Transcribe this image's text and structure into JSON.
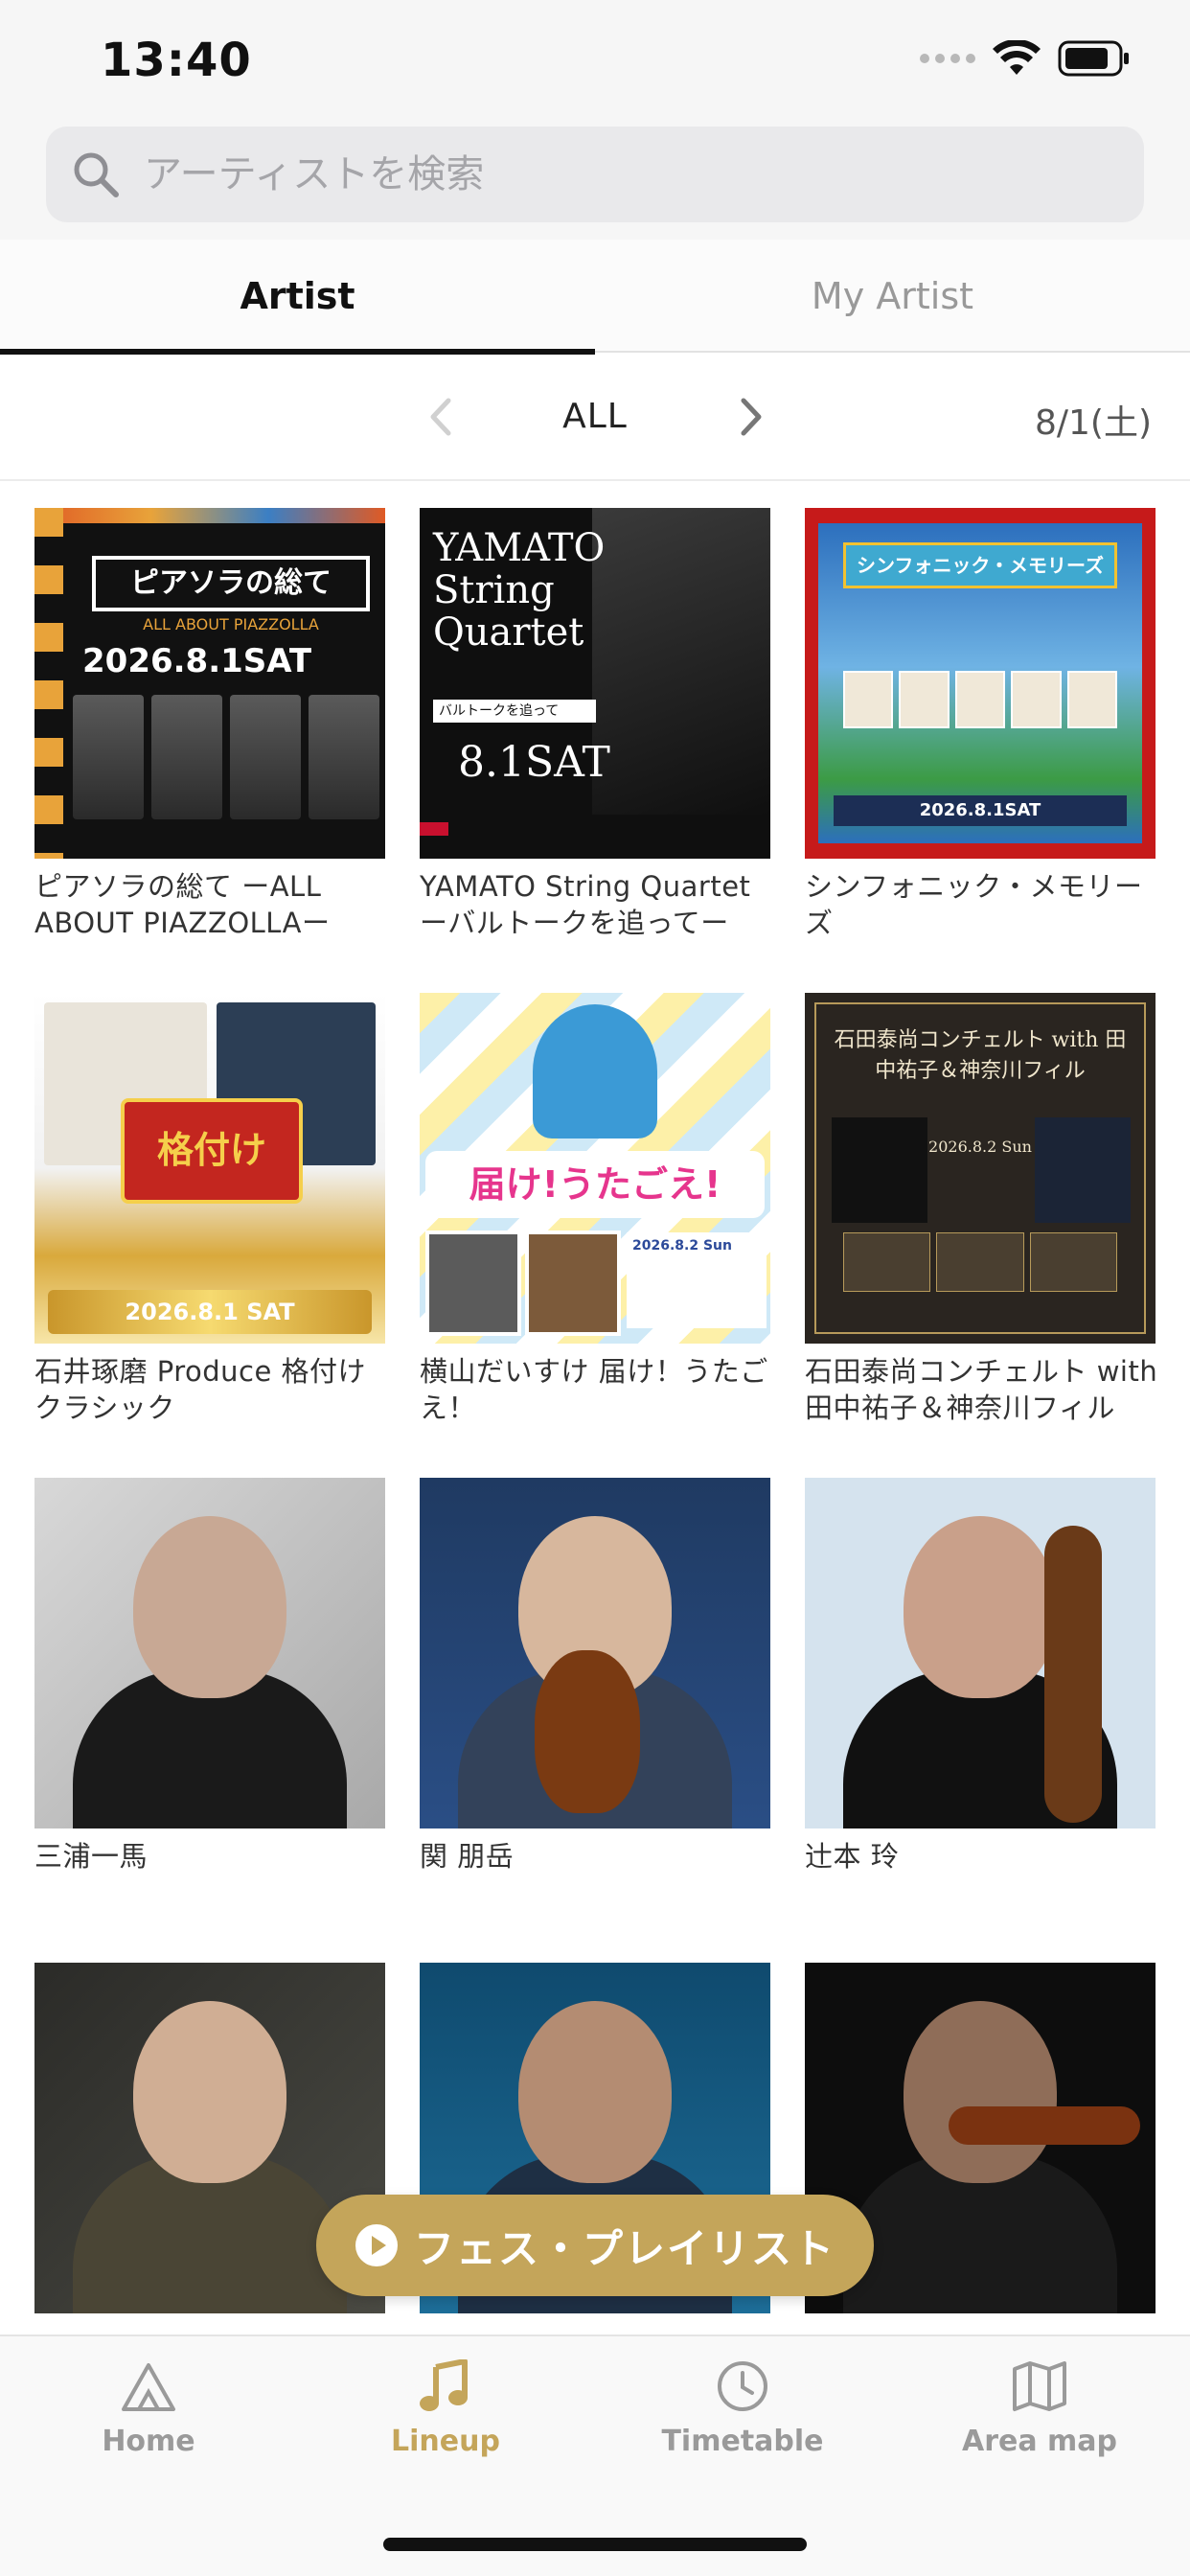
{
  "status": {
    "time": "13:40"
  },
  "search": {
    "placeholder": "アーティストを検索"
  },
  "tabs": [
    {
      "label": "Artist",
      "active": true
    },
    {
      "label": "My Artist",
      "active": false
    }
  ],
  "filter": {
    "label": "ALL",
    "date": "8/1(土)"
  },
  "cards": [
    {
      "title": "ピアソラの総て ーALL ABOUT PIAZZOLLAー",
      "poster_title": "ピアソラの総て",
      "poster_sub": "ALL ABOUT PIAZZOLLA",
      "poster_date": "2026.8.1SAT"
    },
    {
      "title": "YAMATO String Quartet ーバルトークを追ってー",
      "poster_title": "YAMATO String Quartet",
      "poster_sub": "バルトークを追って",
      "poster_date": "8.1SAT"
    },
    {
      "title": "シンフォニック・メモリーズ",
      "poster_title": "シンフォニック・メモリーズ",
      "poster_date": "2026.8.1SAT"
    },
    {
      "title": "石井琢磨 Produce 格付けクラシック",
      "poster_title": "格付け",
      "poster_date": "2026.8.1 SAT"
    },
    {
      "title": "横山だいすけ 届け！うたごえ！",
      "poster_title": "届け!うたごえ!",
      "poster_date": "2026.8.2 Sun"
    },
    {
      "title": "石田泰尚コンチェルト with 田中祐子＆神奈川フィル",
      "poster_title": "石田泰尚コンチェルト with 田中祐子＆神奈川フィル",
      "poster_date": "2026.8.2 Sun"
    },
    {
      "title": "三浦一馬"
    },
    {
      "title": "関 朋岳"
    },
    {
      "title": "辻本 玲"
    },
    {
      "title": ""
    },
    {
      "title": ""
    },
    {
      "title": ""
    }
  ],
  "fab": {
    "label": "フェス・プレイリスト"
  },
  "tabbar": [
    {
      "label": "Home",
      "icon": "home-icon",
      "active": false
    },
    {
      "label": "Lineup",
      "icon": "music-note-icon",
      "active": true
    },
    {
      "label": "Timetable",
      "icon": "clock-icon",
      "active": false
    },
    {
      "label": "Area map",
      "icon": "map-icon",
      "active": false
    }
  ],
  "colors": {
    "accent": "#c4a55a",
    "text": "#222222",
    "muted": "#9a9a9a"
  }
}
